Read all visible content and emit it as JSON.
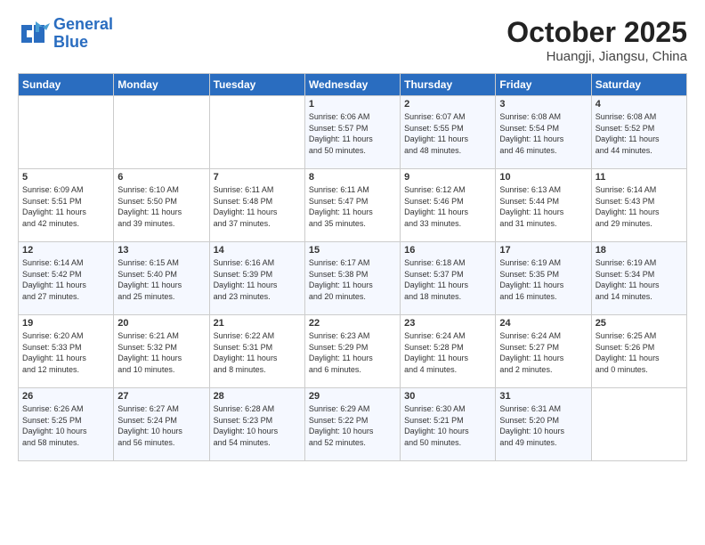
{
  "logo": {
    "line1": "General",
    "line2": "Blue"
  },
  "title": "October 2025",
  "subtitle": "Huangji, Jiangsu, China",
  "weekdays": [
    "Sunday",
    "Monday",
    "Tuesday",
    "Wednesday",
    "Thursday",
    "Friday",
    "Saturday"
  ],
  "weeks": [
    [
      {
        "day": "",
        "info": ""
      },
      {
        "day": "",
        "info": ""
      },
      {
        "day": "",
        "info": ""
      },
      {
        "day": "1",
        "info": "Sunrise: 6:06 AM\nSunset: 5:57 PM\nDaylight: 11 hours\nand 50 minutes."
      },
      {
        "day": "2",
        "info": "Sunrise: 6:07 AM\nSunset: 5:55 PM\nDaylight: 11 hours\nand 48 minutes."
      },
      {
        "day": "3",
        "info": "Sunrise: 6:08 AM\nSunset: 5:54 PM\nDaylight: 11 hours\nand 46 minutes."
      },
      {
        "day": "4",
        "info": "Sunrise: 6:08 AM\nSunset: 5:52 PM\nDaylight: 11 hours\nand 44 minutes."
      }
    ],
    [
      {
        "day": "5",
        "info": "Sunrise: 6:09 AM\nSunset: 5:51 PM\nDaylight: 11 hours\nand 42 minutes."
      },
      {
        "day": "6",
        "info": "Sunrise: 6:10 AM\nSunset: 5:50 PM\nDaylight: 11 hours\nand 39 minutes."
      },
      {
        "day": "7",
        "info": "Sunrise: 6:11 AM\nSunset: 5:48 PM\nDaylight: 11 hours\nand 37 minutes."
      },
      {
        "day": "8",
        "info": "Sunrise: 6:11 AM\nSunset: 5:47 PM\nDaylight: 11 hours\nand 35 minutes."
      },
      {
        "day": "9",
        "info": "Sunrise: 6:12 AM\nSunset: 5:46 PM\nDaylight: 11 hours\nand 33 minutes."
      },
      {
        "day": "10",
        "info": "Sunrise: 6:13 AM\nSunset: 5:44 PM\nDaylight: 11 hours\nand 31 minutes."
      },
      {
        "day": "11",
        "info": "Sunrise: 6:14 AM\nSunset: 5:43 PM\nDaylight: 11 hours\nand 29 minutes."
      }
    ],
    [
      {
        "day": "12",
        "info": "Sunrise: 6:14 AM\nSunset: 5:42 PM\nDaylight: 11 hours\nand 27 minutes."
      },
      {
        "day": "13",
        "info": "Sunrise: 6:15 AM\nSunset: 5:40 PM\nDaylight: 11 hours\nand 25 minutes."
      },
      {
        "day": "14",
        "info": "Sunrise: 6:16 AM\nSunset: 5:39 PM\nDaylight: 11 hours\nand 23 minutes."
      },
      {
        "day": "15",
        "info": "Sunrise: 6:17 AM\nSunset: 5:38 PM\nDaylight: 11 hours\nand 20 minutes."
      },
      {
        "day": "16",
        "info": "Sunrise: 6:18 AM\nSunset: 5:37 PM\nDaylight: 11 hours\nand 18 minutes."
      },
      {
        "day": "17",
        "info": "Sunrise: 6:19 AM\nSunset: 5:35 PM\nDaylight: 11 hours\nand 16 minutes."
      },
      {
        "day": "18",
        "info": "Sunrise: 6:19 AM\nSunset: 5:34 PM\nDaylight: 11 hours\nand 14 minutes."
      }
    ],
    [
      {
        "day": "19",
        "info": "Sunrise: 6:20 AM\nSunset: 5:33 PM\nDaylight: 11 hours\nand 12 minutes."
      },
      {
        "day": "20",
        "info": "Sunrise: 6:21 AM\nSunset: 5:32 PM\nDaylight: 11 hours\nand 10 minutes."
      },
      {
        "day": "21",
        "info": "Sunrise: 6:22 AM\nSunset: 5:31 PM\nDaylight: 11 hours\nand 8 minutes."
      },
      {
        "day": "22",
        "info": "Sunrise: 6:23 AM\nSunset: 5:29 PM\nDaylight: 11 hours\nand 6 minutes."
      },
      {
        "day": "23",
        "info": "Sunrise: 6:24 AM\nSunset: 5:28 PM\nDaylight: 11 hours\nand 4 minutes."
      },
      {
        "day": "24",
        "info": "Sunrise: 6:24 AM\nSunset: 5:27 PM\nDaylight: 11 hours\nand 2 minutes."
      },
      {
        "day": "25",
        "info": "Sunrise: 6:25 AM\nSunset: 5:26 PM\nDaylight: 11 hours\nand 0 minutes."
      }
    ],
    [
      {
        "day": "26",
        "info": "Sunrise: 6:26 AM\nSunset: 5:25 PM\nDaylight: 10 hours\nand 58 minutes."
      },
      {
        "day": "27",
        "info": "Sunrise: 6:27 AM\nSunset: 5:24 PM\nDaylight: 10 hours\nand 56 minutes."
      },
      {
        "day": "28",
        "info": "Sunrise: 6:28 AM\nSunset: 5:23 PM\nDaylight: 10 hours\nand 54 minutes."
      },
      {
        "day": "29",
        "info": "Sunrise: 6:29 AM\nSunset: 5:22 PM\nDaylight: 10 hours\nand 52 minutes."
      },
      {
        "day": "30",
        "info": "Sunrise: 6:30 AM\nSunset: 5:21 PM\nDaylight: 10 hours\nand 50 minutes."
      },
      {
        "day": "31",
        "info": "Sunrise: 6:31 AM\nSunset: 5:20 PM\nDaylight: 10 hours\nand 49 minutes."
      },
      {
        "day": "",
        "info": ""
      }
    ]
  ]
}
